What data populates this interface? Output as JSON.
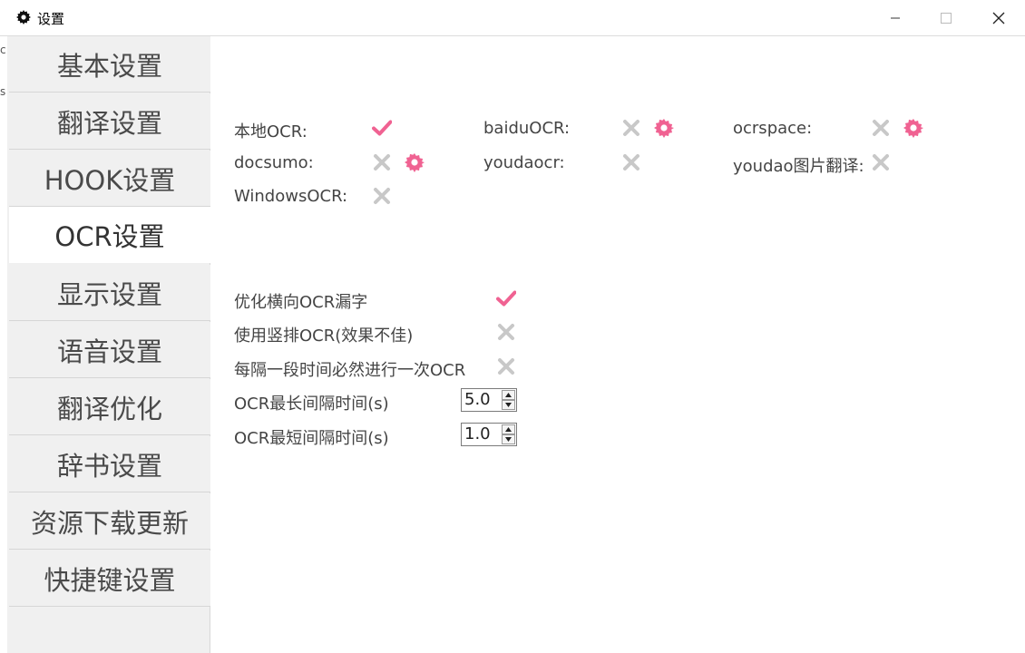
{
  "window": {
    "title": "设置",
    "icon": "gear-icon",
    "controls": [
      "minimize-icon",
      "maximize-icon",
      "close-icon"
    ]
  },
  "sidebar": {
    "items": [
      {
        "label": "基本设置",
        "active": false
      },
      {
        "label": "翻译设置",
        "active": false
      },
      {
        "label": "HOOK设置",
        "active": false
      },
      {
        "label": "OCR设置",
        "active": true
      },
      {
        "label": "显示设置",
        "active": false
      },
      {
        "label": "语音设置",
        "active": false
      },
      {
        "label": "翻译优化",
        "active": false
      },
      {
        "label": "辞书设置",
        "active": false
      },
      {
        "label": "资源下载更新",
        "active": false
      },
      {
        "label": "快捷键设置",
        "active": false
      }
    ]
  },
  "ocr_engines": [
    {
      "label": "本地OCR:",
      "enabled": true,
      "has_settings": false
    },
    {
      "label": "baiduOCR:",
      "enabled": false,
      "has_settings": true
    },
    {
      "label": "ocrspace:",
      "enabled": false,
      "has_settings": true
    },
    {
      "label": "docsumo:",
      "enabled": false,
      "has_settings": true
    },
    {
      "label": "youdaocr:",
      "enabled": false,
      "has_settings": false
    },
    {
      "label": "youdao图片翻译:",
      "enabled": false,
      "has_settings": false
    },
    {
      "label": "WindowsOCR:",
      "enabled": false,
      "has_settings": false
    }
  ],
  "options": [
    {
      "label": "优化横向OCR漏字",
      "enabled": true
    },
    {
      "label": "使用竖排OCR(效果不佳)",
      "enabled": false
    },
    {
      "label": "每隔一段时间必然进行一次OCR",
      "enabled": false
    }
  ],
  "spinners": [
    {
      "label": "OCR最长间隔时间(s)",
      "value": "5.0"
    },
    {
      "label": "OCR最短间隔时间(s)",
      "value": "1.0"
    }
  ],
  "colors": {
    "accent_check": "#f06292",
    "disabled_cross": "#c8c8c8",
    "settings_gear": "#f06292",
    "sidebar_bg": "#f0f0f0"
  },
  "left_edge_fragments": [
    "c",
    "s"
  ]
}
